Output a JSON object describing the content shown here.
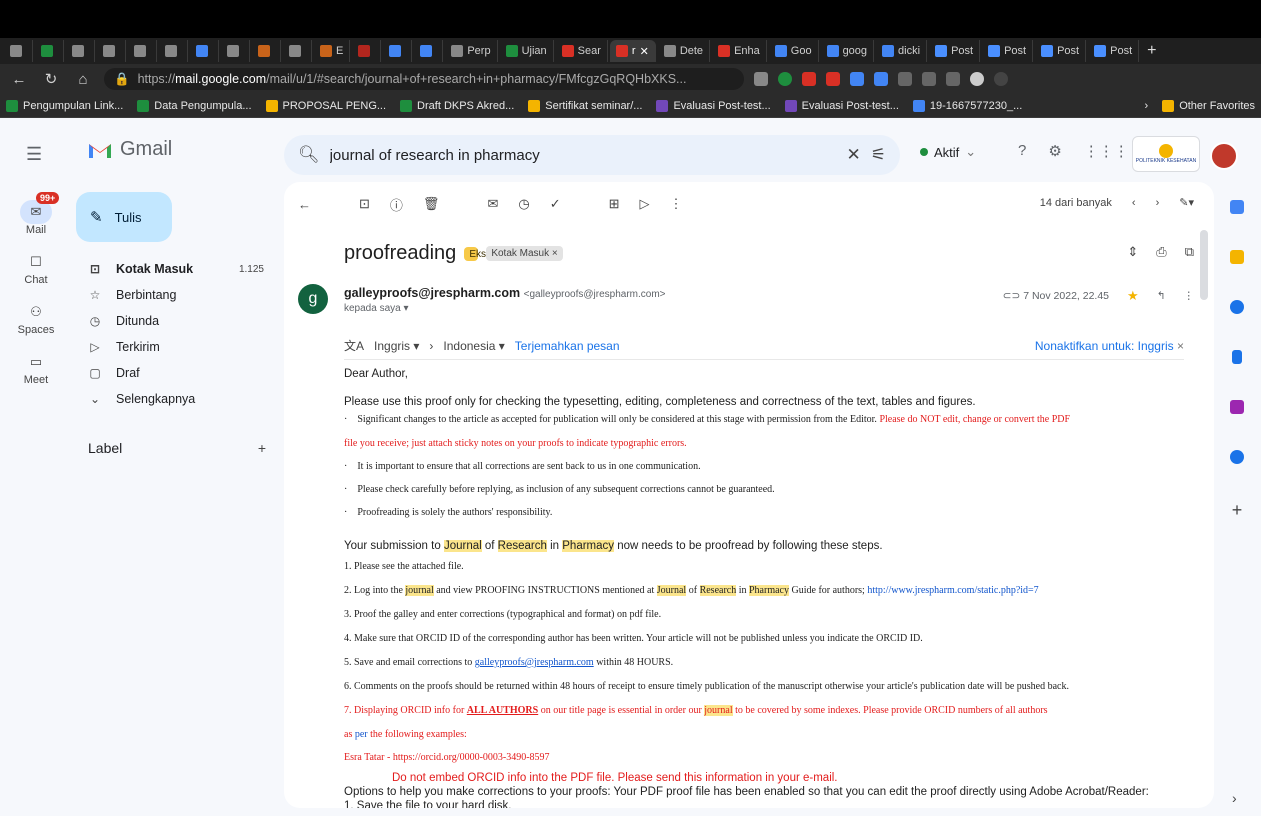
{
  "browser": {
    "tabs": [
      {
        "label": "",
        "color": "#888"
      },
      {
        "label": "",
        "color": "#1e8e3e"
      },
      {
        "label": "",
        "color": "#888"
      },
      {
        "label": "",
        "color": "#888"
      },
      {
        "label": "",
        "color": "#888"
      },
      {
        "label": "",
        "color": "#888"
      },
      {
        "label": "",
        "color": "#4285f4"
      },
      {
        "label": "",
        "color": "#888"
      },
      {
        "label": "",
        "color": "#c8631a"
      },
      {
        "label": "",
        "color": "#888"
      },
      {
        "label": "E",
        "color": "#c8631a"
      },
      {
        "label": "",
        "color": "#b3261e"
      },
      {
        "label": "",
        "color": "#4285f4"
      },
      {
        "label": "",
        "color": "#4285f4"
      },
      {
        "label": "Perp",
        "color": "#888"
      },
      {
        "label": "Ujian",
        "color": "#1e8e3e"
      },
      {
        "label": "Sear",
        "color": "#d93025"
      },
      {
        "label": "r",
        "color": "#d93025",
        "active": true
      },
      {
        "label": "Dete",
        "color": "#888"
      },
      {
        "label": "Enha",
        "color": "#d93025"
      },
      {
        "label": "Goo",
        "color": "#4285f4"
      },
      {
        "label": "goog",
        "color": "#4285f4"
      },
      {
        "label": "dicki",
        "color": "#4285f4"
      },
      {
        "label": "Post",
        "color": "#4a8fff"
      },
      {
        "label": "Post",
        "color": "#4a8fff"
      },
      {
        "label": "Post",
        "color": "#4a8fff"
      },
      {
        "label": "Post",
        "color": "#4a8fff"
      }
    ],
    "url_prefix": "https://",
    "url_host": "mail.google.com",
    "url_rest": "/mail/u/1/#search/journal+of+research+in+pharmacy/FMfcgzGqRQHbXKS...",
    "bookmarks": [
      {
        "label": "Pengumpulan Link...",
        "color": "#1e8e3e"
      },
      {
        "label": "Data Pengumpula...",
        "color": "#1e8e3e"
      },
      {
        "label": "PROPOSAL PENG...",
        "color": "#f4b400"
      },
      {
        "label": "Draft DKPS Akred...",
        "color": "#1e8e3e"
      },
      {
        "label": "Sertifikat seminar/...",
        "color": "#f4b400"
      },
      {
        "label": "Evaluasi Post-test...",
        "color": "#7248b9"
      },
      {
        "label": "Evaluasi Post-test...",
        "color": "#7248b9"
      },
      {
        "label": "19-1667577230_...",
        "color": "#4285f4"
      }
    ],
    "other_favorites": "Other Favorites"
  },
  "gmail": {
    "logo_text": "Gmail",
    "search_value": "journal of research in pharmacy",
    "status": "Aktif",
    "org_logo_text": "POLITEKNIK KESEHATAN",
    "rail": [
      {
        "label": "Mail",
        "icon": "mail-icon",
        "badge": "99+"
      },
      {
        "label": "Chat",
        "icon": "chat-icon"
      },
      {
        "label": "Spaces",
        "icon": "spaces-icon"
      },
      {
        "label": "Meet",
        "icon": "meet-icon"
      }
    ],
    "compose_label": "Tulis",
    "nav": [
      {
        "label": "Kotak Masuk",
        "count": "1.125",
        "icon": "inbox-icon",
        "bold": true
      },
      {
        "label": "Berbintang",
        "icon": "star-icon"
      },
      {
        "label": "Ditunda",
        "icon": "clock-icon"
      },
      {
        "label": "Terkirim",
        "icon": "send-icon"
      },
      {
        "label": "Draf",
        "icon": "draft-icon"
      },
      {
        "label": "Selengkapnya",
        "icon": "chevron-down-icon"
      }
    ],
    "label_heading": "Label",
    "toolbar_count": "14 dari banyak"
  },
  "email": {
    "subject": "proofreading",
    "chip_external": "Eksternal",
    "chip_inbox": "Kotak Masuk ×",
    "avatar_letter": "g",
    "sender_name": "galleyproofs@jrespharm.com",
    "sender_addr": "<galleyproofs@jrespharm.com>",
    "to": "kepada saya ▾",
    "date": "7 Nov 2022, 22.45",
    "translate_from": "Inggris ▾",
    "translate_to": "Indonesia ▾",
    "translate_link": "Terjemahkan pesan",
    "translate_off": "Nonaktifkan untuk: Inggris",
    "greeting": "Dear Author,",
    "intro": "Please use this proof only for checking the typesetting, editing, completeness and correctness of the text, tables and figures.",
    "bullet1_black": "Significant changes to the article as accepted for publication will only be considered at this stage with permission from the Editor.",
    "bullet1_red": "Please do NOT edit, change or convert the PDF",
    "bullet1_red2": "file you receive; just attach sticky notes on your proofs to indicate typographic errors.",
    "bullet2": "It is important to ensure that all corrections are sent back to us in one communication.",
    "bullet3": "Please check carefully before replying, as inclusion of any subsequent corrections cannot be guaranteed.",
    "bullet4": "Proofreading is solely the authors' responsibility.",
    "submission_a": "Your submission to",
    "submission_journal": "Journal",
    "submission_of": "of",
    "submission_research": "Research",
    "submission_in": "in",
    "submission_pharmacy": "Pharmacy",
    "submission_b": "now needs to be proofread by following these steps.",
    "step1": "1.   Please see the attached file.",
    "step2_a": "2.   Log into the",
    "step2_journal": "journal",
    "step2_b": "and view PROOFING INSTRUCTIONS mentioned at",
    "step2_J": "Journal",
    "step2_of": "of",
    "step2_R": "Research",
    "step2_in": "in",
    "step2_P": "Pharmacy",
    "step2_c": "Guide for authors;",
    "step2_link": "http://www.jrespharm.com/static.php?id=7",
    "step3": "3.   Proof the galley and enter corrections (typographical and format) on pdf file.",
    "step4": "4.   Make sure that ORCID ID of the corresponding author has been written. Your article will not be published unless you indicate the ORCID ID.",
    "step5_a": "5.   Save and email corrections to",
    "step5_link": "galleyproofs@jrespharm.com",
    "step5_b": "within 48 HOURS.",
    "step6": "6.   Comments on the proofs should be returned within 48 hours of receipt to ensure timely publication of the manuscript otherwise your article's publication date will be pushed back.",
    "step7_a": "7.     Displaying ORCID info for",
    "step7_bold": "ALL AUTHORS",
    "step7_b": "on our title page is essential in order our",
    "step7_journal": "journal",
    "step7_c": "to be covered by some indexes. Please provide ORCID numbers of all authors",
    "step7_d": "as",
    "step7_per": "per",
    "step7_e": "the following examples:",
    "example": "Esra Tatar - https://orcid.org/0000-0003-3490-8597",
    "no_embed": "Do not embed ORCID info into the PDF file. Please send this information in your e-mail.",
    "options": "Options to help you make corrections to your proofs: Your PDF proof file has been enabled so that you can edit the proof directly using Adobe Acrobat/Reader:",
    "save": "1. Save the file to your hard disk."
  }
}
